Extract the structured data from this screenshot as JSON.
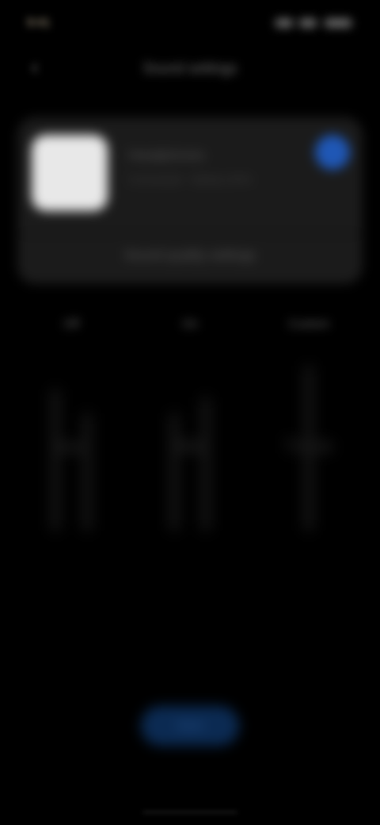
{
  "status_bar": {
    "time": "9:41",
    "icons": [
      "signal-icon",
      "wifi-icon",
      "battery-icon"
    ]
  },
  "header": {
    "back_glyph": "‹",
    "title": "Sound settings"
  },
  "device_card": {
    "name": "Headphones",
    "subtitle": "Connected · Battery 80%",
    "toggle_on": true,
    "action_label": "Sound quality settings"
  },
  "mode_tabs": [
    {
      "label": "Off"
    },
    {
      "label": "On"
    },
    {
      "label": "Custom"
    }
  ],
  "equalizer": {
    "columns": [
      {
        "label": "Bass",
        "levels": [
          0.62,
          0.48
        ]
      },
      {
        "label": "Mid",
        "levels": [
          0.5,
          0.55
        ]
      },
      {
        "label": "Treble",
        "levels": [
          0.8
        ]
      }
    ]
  },
  "primary_button": {
    "label": "Save"
  },
  "colors": {
    "background": "#000000",
    "card": "#1b1b1b",
    "accent": "#1f57b5",
    "button": "#0b2a52"
  }
}
